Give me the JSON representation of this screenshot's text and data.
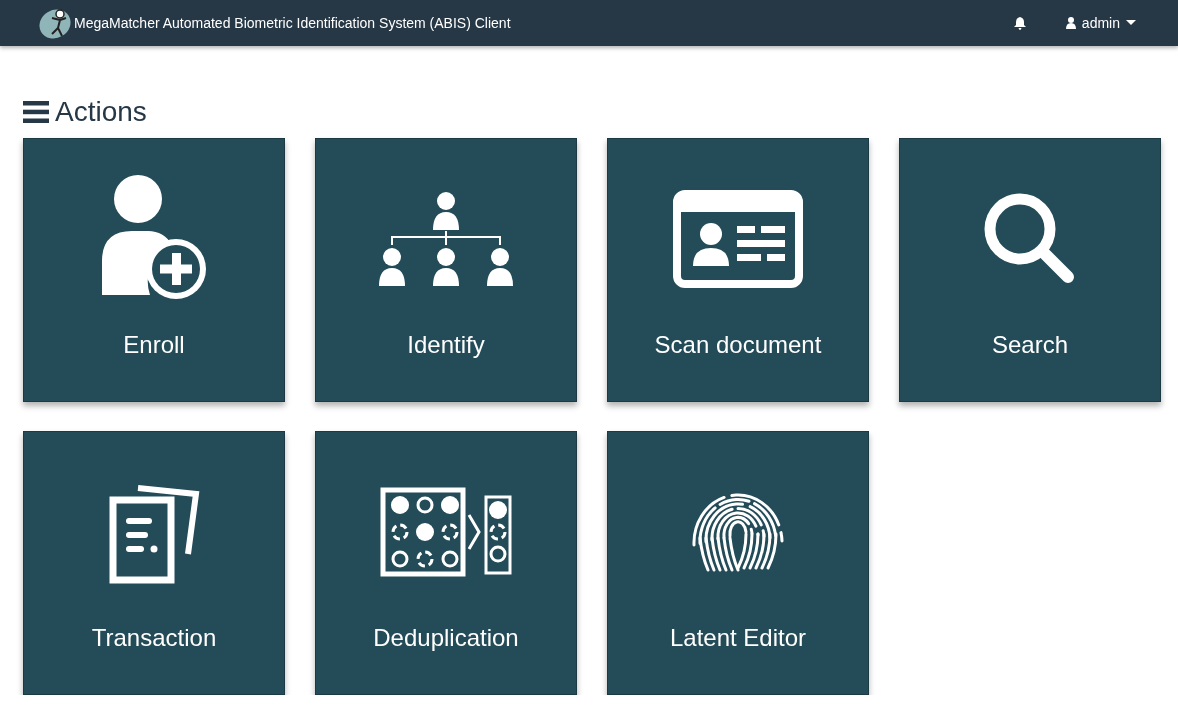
{
  "header": {
    "title": "MegaMatcher Automated Biometric Identification System (ABIS) Client",
    "user": "admin"
  },
  "section": {
    "title": "Actions"
  },
  "actions": [
    {
      "kind": "enroll",
      "label": "Enroll"
    },
    {
      "kind": "identify",
      "label": "Identify"
    },
    {
      "kind": "scan",
      "label": "Scan document"
    },
    {
      "kind": "search",
      "label": "Search"
    },
    {
      "kind": "transaction",
      "label": "Transaction"
    },
    {
      "kind": "dedup",
      "label": "Deduplication"
    },
    {
      "kind": "latent",
      "label": "Latent Editor"
    }
  ]
}
